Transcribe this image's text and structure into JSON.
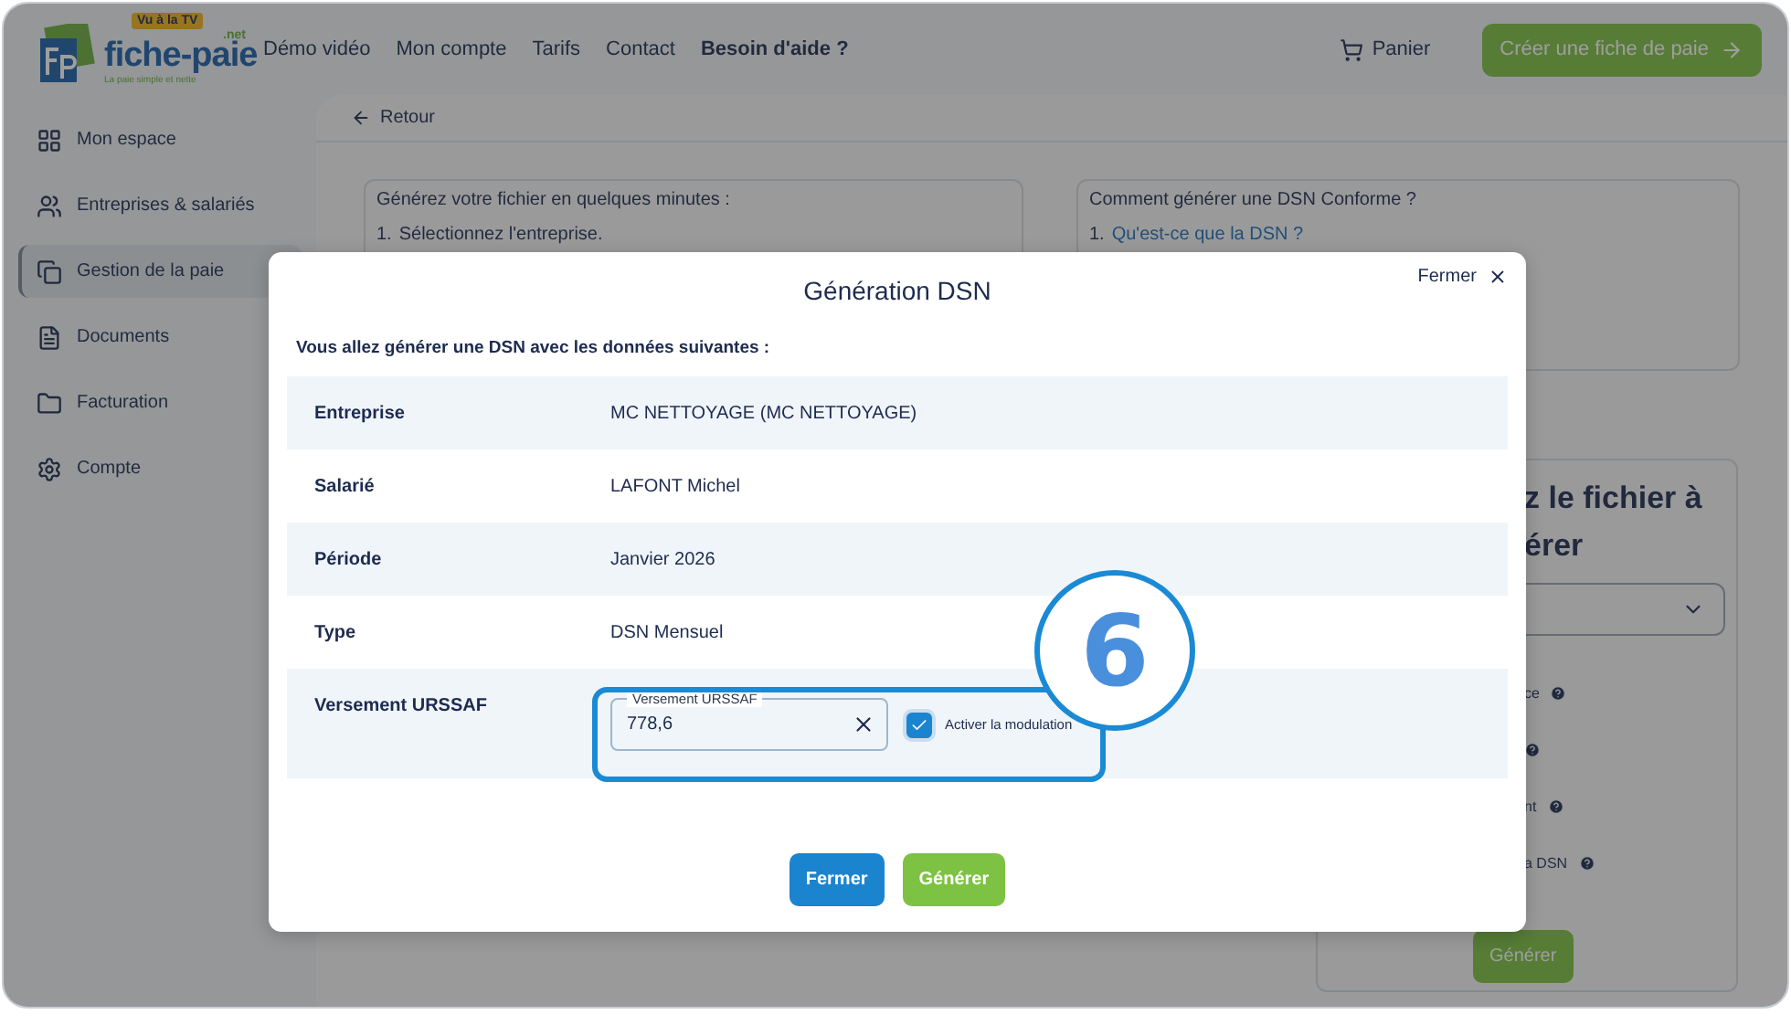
{
  "header": {
    "logo": {
      "badge": "Vu à la TV",
      "name": "fiche-paie",
      "suffix": ".net",
      "tagline": "La paie simple et nette"
    },
    "nav": [
      {
        "label": "Démo vidéo",
        "bold": false
      },
      {
        "label": "Mon compte",
        "bold": false
      },
      {
        "label": "Tarifs",
        "bold": false
      },
      {
        "label": "Contact",
        "bold": false
      },
      {
        "label": "Besoin d'aide ?",
        "bold": true
      }
    ],
    "cart": "Panier",
    "cta": "Créer une fiche de paie"
  },
  "sidebar": {
    "items": [
      {
        "label": "Mon espace",
        "kind": "grid",
        "selected": false
      },
      {
        "label": "Entreprises & salariés",
        "kind": "users",
        "selected": false
      },
      {
        "label": "Gestion de la paie",
        "kind": "copy",
        "selected": true
      },
      {
        "label": "Documents",
        "kind": "file",
        "selected": false
      },
      {
        "label": "Facturation",
        "kind": "folder",
        "selected": false
      },
      {
        "label": "Compte",
        "kind": "gear",
        "selected": false
      }
    ]
  },
  "back": "Retour",
  "cards": [
    {
      "title": "Générez votre fichier en quelques minutes :",
      "steps": [
        {
          "number": "1.",
          "text": "Sélectionnez l'entreprise.",
          "link": false
        }
      ]
    },
    {
      "title": "Comment générer une DSN Conforme ?",
      "steps": [
        {
          "number": "1.",
          "text": "Qu'est-ce que la DSN ?",
          "link": true
        }
      ]
    }
  ],
  "side_panel": {
    "title_lines": [
      "z le fichier à",
      "érer"
    ],
    "options": [
      {
        "label": "ce",
        "help": true
      },
      {
        "help": true
      },
      {
        "label": "nt",
        "help": true
      },
      {
        "label": "a DSN",
        "help": true
      }
    ],
    "button": "Générer"
  },
  "modal": {
    "title": "Génération DSN",
    "close": "Fermer",
    "intro": "Vous allez générer une DSN avec les données suivantes :",
    "rows": [
      {
        "label": "Entreprise",
        "kind": "text",
        "value": "MC NETTOYAGE (MC NETTOYAGE)"
      },
      {
        "label": "Salarié",
        "kind": "text",
        "value": "LAFONT Michel"
      },
      {
        "label": "Période",
        "kind": "text",
        "value": "Janvier 2026"
      },
      {
        "label": "Type",
        "kind": "text",
        "value": "DSN Mensuel"
      },
      {
        "label": "Versement URSSAF",
        "kind": "input",
        "field_label": "Versement URSSAF",
        "value": "778,6",
        "checkbox": {
          "label": "Activer la modulation",
          "checked": true
        }
      }
    ],
    "buttons": [
      {
        "label": "Fermer",
        "kind": "primary"
      },
      {
        "label": "Générer",
        "kind": "success"
      }
    ]
  },
  "callout": {
    "number": "6"
  }
}
